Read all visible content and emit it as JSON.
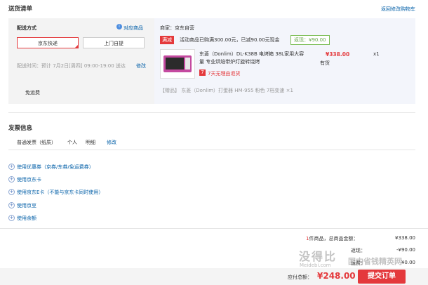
{
  "section_title": "送货清单",
  "back_link": "返回修改购物车",
  "delivery": {
    "label": "配送方式",
    "help_label": "对应商品",
    "options": [
      "京东快递",
      "上门自提"
    ],
    "time_label": "配送时间：预计 7月2日[周四] 09:00-19:00 送达",
    "modify": "修改",
    "free_shipping": "免运费"
  },
  "shop": {
    "name": "商家：京东自营",
    "promo_tag": "满减",
    "promo_text": "活动商品已购满300.00元，已减90.00元现金",
    "promo_badge": "返现：¥90.00"
  },
  "product": {
    "title": "东菱（Donlim）DL-K38B 电烤箱 38L家用大容量 专业烘焙带炉灯旋转烧烤",
    "price": "¥338.00",
    "qty": "x1",
    "stock": "有货",
    "return_icon_text": "7",
    "return_text": "7天无理由退货",
    "gift": "【赠品】 东菱（Donlim）打蛋器 HM-955 粉色 7档变速 ×1"
  },
  "invoice": {
    "title": "发票信息",
    "type": "普通发票（纸质）",
    "person": "个人",
    "detail": "明细",
    "modify": "修改"
  },
  "coupons": [
    "使用优惠券（京券/东券/免运费券）",
    "使用京东卡",
    "使用京东E卡（不能与京东卡同时使用）",
    "使用京豆",
    "使用余额"
  ],
  "summary": {
    "count": "1",
    "count_label": "件商品，总商品金额：",
    "total": "¥338.00",
    "cashback_label": "返现：",
    "cashback": "-¥90.00",
    "shipping_label": "运费：",
    "shipping": "¥0.00",
    "payable_label": "应付总额：",
    "payable": "¥248.00",
    "submit": "提交订单"
  },
  "watermark": {
    "brand": "没得比",
    "domain": "Meidebi.com",
    "slogan": "国内省钱精英网"
  },
  "colors": {
    "accent": "#e4393c",
    "link": "#005ea7",
    "submit": "#e4393c"
  }
}
